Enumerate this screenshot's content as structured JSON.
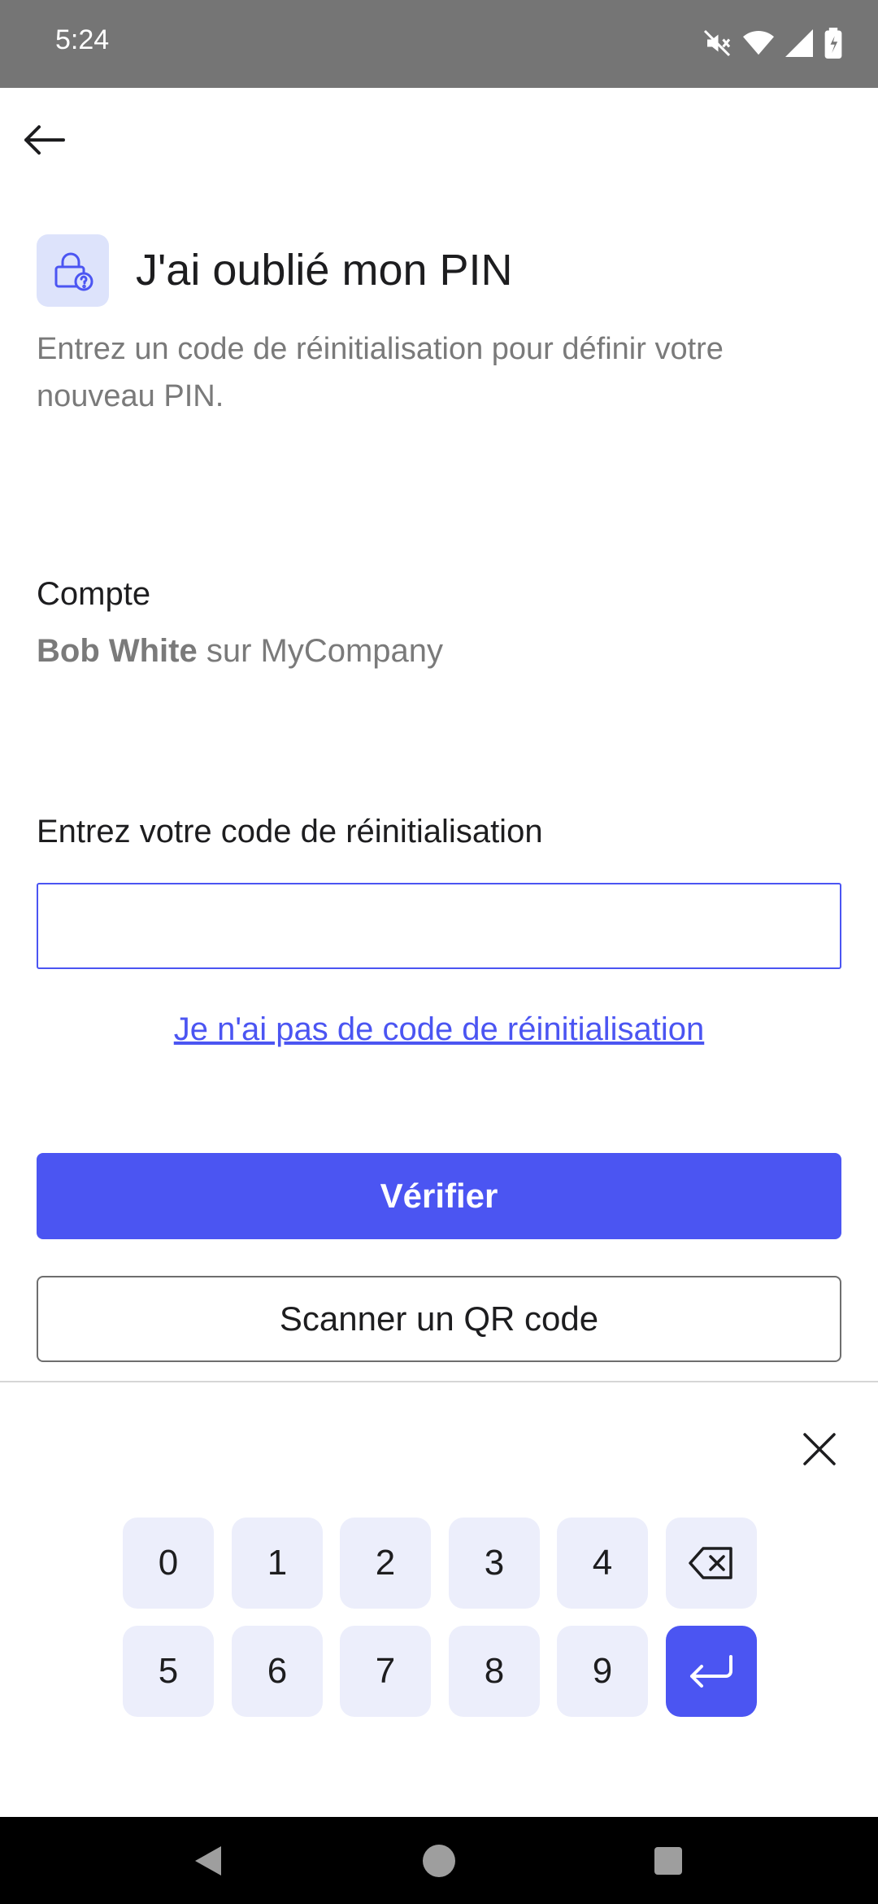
{
  "status_bar": {
    "time": "5:24"
  },
  "header": {
    "title": "J'ai oublié mon PIN",
    "subtitle": "Entrez un code de réinitialisation pour définir votre nouveau PIN."
  },
  "account": {
    "label": "Compte",
    "name": "Bob White",
    "suffix": " sur MyCompany"
  },
  "reset_code": {
    "label": "Entrez votre code de réinitialisation",
    "value": "",
    "placeholder": ""
  },
  "no_code_link": "Je n'ai pas de code de réinitialisation",
  "buttons": {
    "verify": "Vérifier",
    "scan_qr": "Scanner un QR code"
  },
  "keypad": {
    "row1": [
      "0",
      "1",
      "2",
      "3",
      "4"
    ],
    "row2": [
      "5",
      "6",
      "7",
      "8",
      "9"
    ]
  },
  "colors": {
    "accent": "#4b55f2",
    "icon_bg": "#dde3fb",
    "key_bg": "#eceefb",
    "status_bar": "#757575"
  },
  "icons": [
    "back-arrow-icon",
    "lock-question-icon",
    "close-icon",
    "backspace-icon",
    "enter-icon",
    "mute-icon",
    "wifi-icon",
    "signal-icon",
    "battery-icon"
  ]
}
